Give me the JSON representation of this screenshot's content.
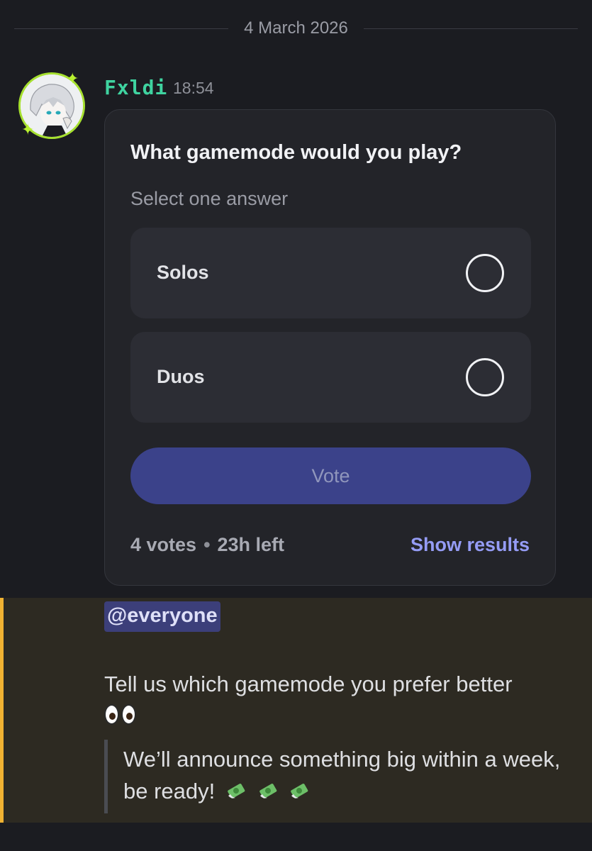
{
  "divider": {
    "date": "4 March 2026"
  },
  "message": {
    "author": "Fxldi",
    "time": "18:54",
    "poll": {
      "question": "What gamemode would you play?",
      "subtitle": "Select one answer",
      "options": [
        {
          "label": "Solos",
          "selected": false
        },
        {
          "label": "Duos",
          "selected": false
        }
      ],
      "vote_label": "Vote",
      "votes": "4 votes",
      "separator": "•",
      "time_left": "23h left",
      "show_results": "Show results"
    }
  },
  "highlighted_message": {
    "mention": "@everyone",
    "text": "Tell us which gamemode you prefer better",
    "emoji_after_text": "eyes-icon",
    "quote": "We’ll announce something big within a week, be ready!",
    "quote_emoji": [
      "money-with-wings-icon",
      "money-with-wings-icon",
      "money-with-wings-icon"
    ]
  },
  "colors": {
    "background": "#1b1c21",
    "username": "#3fd3a0",
    "vote_button": "#3b428a",
    "show_results": "#959cf5",
    "mention_highlight": "#f0b232",
    "mention_bg": "#3c3f7a"
  }
}
